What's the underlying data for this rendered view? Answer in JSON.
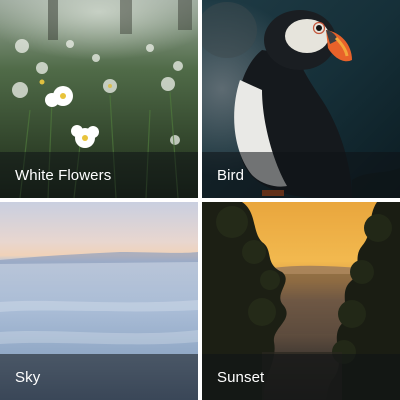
{
  "gallery": {
    "items": [
      {
        "label": "White Flowers",
        "image": "white-flowers-photo"
      },
      {
        "label": "Bird",
        "image": "puffin-photo"
      },
      {
        "label": "Sky",
        "image": "sky-above-clouds-photo"
      },
      {
        "label": "Sunset",
        "image": "sunset-forest-photo"
      }
    ]
  },
  "colors": {
    "caption_overlay": "#0f1216",
    "caption_text": "#ffffff",
    "gutter": "#ffffff"
  }
}
